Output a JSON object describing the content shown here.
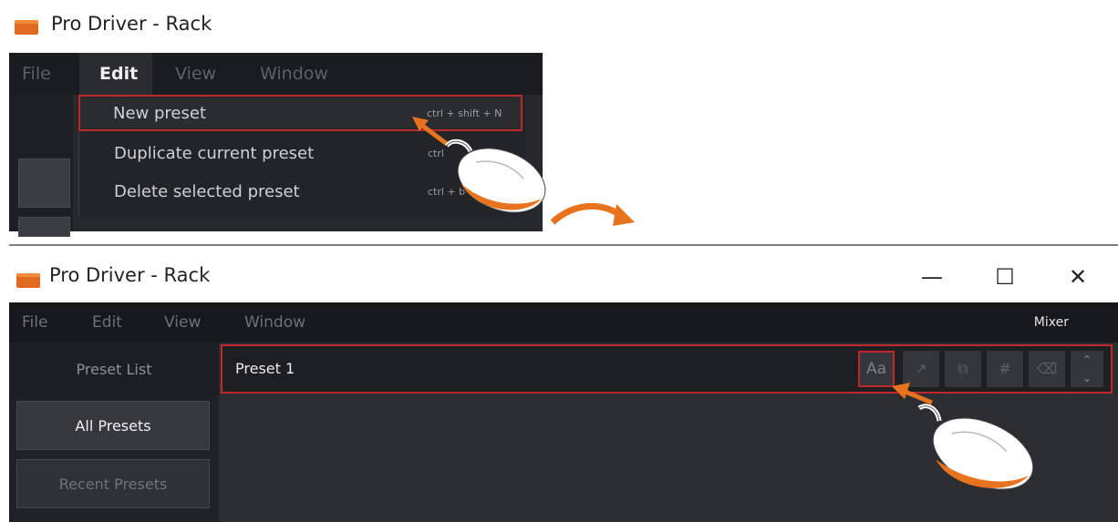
{
  "top_window": {
    "title": "Pro Driver - Rack",
    "menu": [
      "File",
      "Edit",
      "View",
      "Window"
    ],
    "edit_dropdown": [
      {
        "label": "New preset",
        "shortcut": "ctrl + shift + N"
      },
      {
        "label": "Duplicate current preset",
        "shortcut": "ctrl"
      },
      {
        "label": "Delete selected preset",
        "shortcut": "ctrl + b"
      }
    ]
  },
  "bottom_window": {
    "title": "Pro Driver - Rack",
    "controls": {
      "minimize": "—",
      "maximize": "☐",
      "close": "✕"
    },
    "menu": [
      "File",
      "Edit",
      "View",
      "Window"
    ],
    "mixer": "Mixer",
    "sidebar": {
      "header": "Preset List",
      "buttons": [
        "All Presets",
        "Recent Presets"
      ]
    },
    "preset_bar": {
      "name": "Preset 1",
      "tools": [
        "Aa",
        "↗",
        "⧉",
        "#",
        "⌫"
      ],
      "stepper": [
        "⌃",
        "⌄"
      ]
    }
  },
  "colors": {
    "highlight": "#c0272d",
    "accent_orange": "#e8731e",
    "menubar": "#1a1b1d"
  }
}
